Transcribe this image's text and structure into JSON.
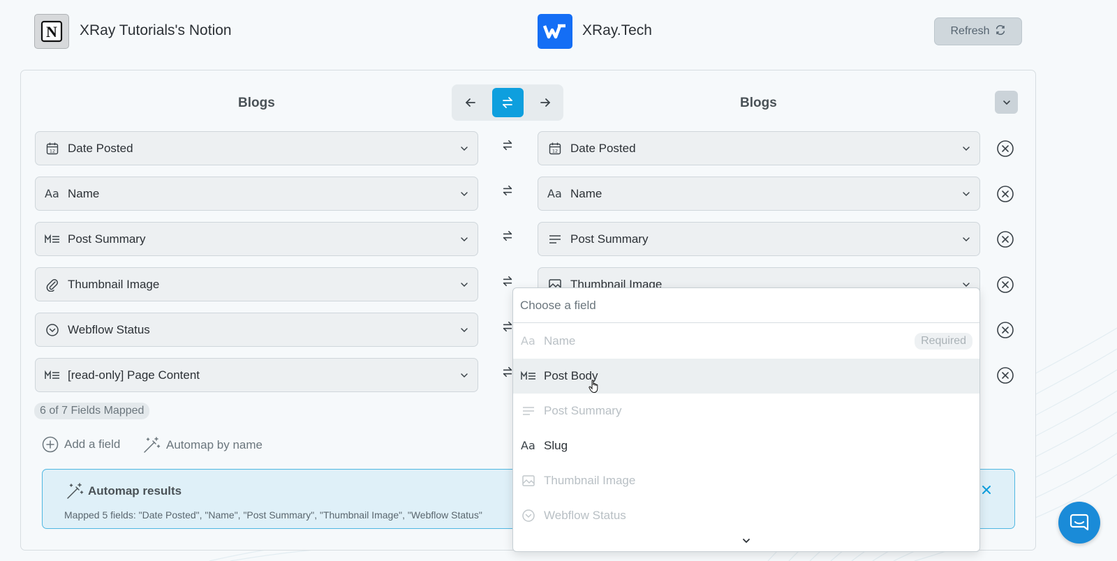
{
  "header": {
    "source_app_name": "XRay Tutorials's Notion",
    "target_app_name": "XRay.Tech",
    "refresh_label": "Refresh"
  },
  "columns": {
    "left_title": "Blogs",
    "right_title": "Blogs"
  },
  "field_rows": [
    {
      "left_label": "Date Posted",
      "left_icon": "calendar-icon",
      "right_label": "Date Posted",
      "right_icon": "calendar-icon"
    },
    {
      "left_label": "Name",
      "left_icon": "text-aa-icon",
      "right_label": "Name",
      "right_icon": "text-aa-icon"
    },
    {
      "left_label": "Post Summary",
      "left_icon": "markdown-icon",
      "right_label": "Post Summary",
      "right_icon": "paragraph-icon"
    },
    {
      "left_label": "Thumbnail Image",
      "left_icon": "paperclip-icon",
      "right_label": "Thumbnail Image",
      "right_icon": "image-icon"
    },
    {
      "left_label": "Webflow Status",
      "left_icon": "circle-chevron-icon"
    },
    {
      "left_label": "[read-only] Page Content",
      "left_icon": "markdown-icon"
    }
  ],
  "mapped_count_label": "6 of 7 Fields Mapped",
  "actions": {
    "add_field_label": "Add a field",
    "automap_label": "Automap by name"
  },
  "automap_results": {
    "title": "Automap results",
    "message": "Mapped 5 fields: \"Date Posted\", \"Name\", \"Post Summary\", \"Thumbnail Image\", \"Webflow Status\""
  },
  "dropdown": {
    "search_placeholder": "Choose a field",
    "items": [
      {
        "label": "Name",
        "icon": "text-aa-icon",
        "disabled": true,
        "tag": "Required"
      },
      {
        "label": "Post Body",
        "icon": "markdown-icon",
        "disabled": false
      },
      {
        "label": "Post Summary",
        "icon": "paragraph-icon",
        "disabled": true
      },
      {
        "label": "Slug",
        "icon": "text-aa-icon",
        "disabled": false
      },
      {
        "label": "Thumbnail Image",
        "icon": "image-icon",
        "disabled": true
      },
      {
        "label": "Webflow Status",
        "icon": "circle-chevron-icon",
        "disabled": true
      }
    ]
  },
  "colors": {
    "accent": "#0e9fde",
    "panel_border": "#4fb7e2",
    "webflow_blue": "#146ef5",
    "chat_blue": "#1a8bd8"
  }
}
